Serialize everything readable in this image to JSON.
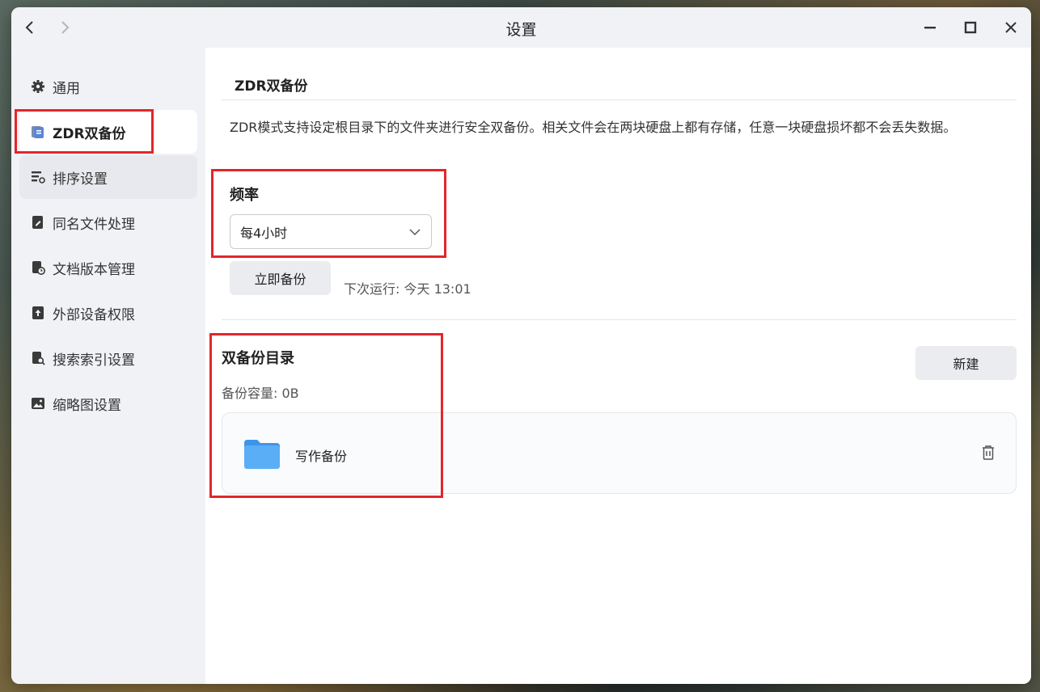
{
  "window": {
    "title": "设置"
  },
  "sidebar": {
    "items": [
      {
        "label": "通用",
        "icon": "gear-icon"
      },
      {
        "label": "ZDR双备份",
        "icon": "backup-icon"
      },
      {
        "label": "排序设置",
        "icon": "sort-settings-icon"
      },
      {
        "label": "同名文件处理",
        "icon": "file-edit-icon"
      },
      {
        "label": "文档版本管理",
        "icon": "document-version-icon"
      },
      {
        "label": "外部设备权限",
        "icon": "external-device-icon"
      },
      {
        "label": "搜索索引设置",
        "icon": "search-index-icon"
      },
      {
        "label": "缩略图设置",
        "icon": "image-icon"
      }
    ]
  },
  "main": {
    "section_title": "ZDR双备份",
    "description": "ZDR模式支持设定根目录下的文件夹进行安全双备份。相关文件会在两块硬盘上都有存储，任意一块硬盘损坏都不会丢失数据。",
    "frequency": {
      "label": "频率",
      "selected": "每4小时"
    },
    "backup_now_label": "立即备份",
    "next_run": "下次运行: 今天 13:01",
    "directory": {
      "title": "双备份目录",
      "capacity": "备份容量: 0B",
      "new_label": "新建",
      "folders": [
        {
          "name": "写作备份"
        }
      ]
    }
  },
  "colors": {
    "highlight": "#e3262b",
    "folder": "#5aaef5",
    "sidebar_bg": "#f1f2f6"
  }
}
